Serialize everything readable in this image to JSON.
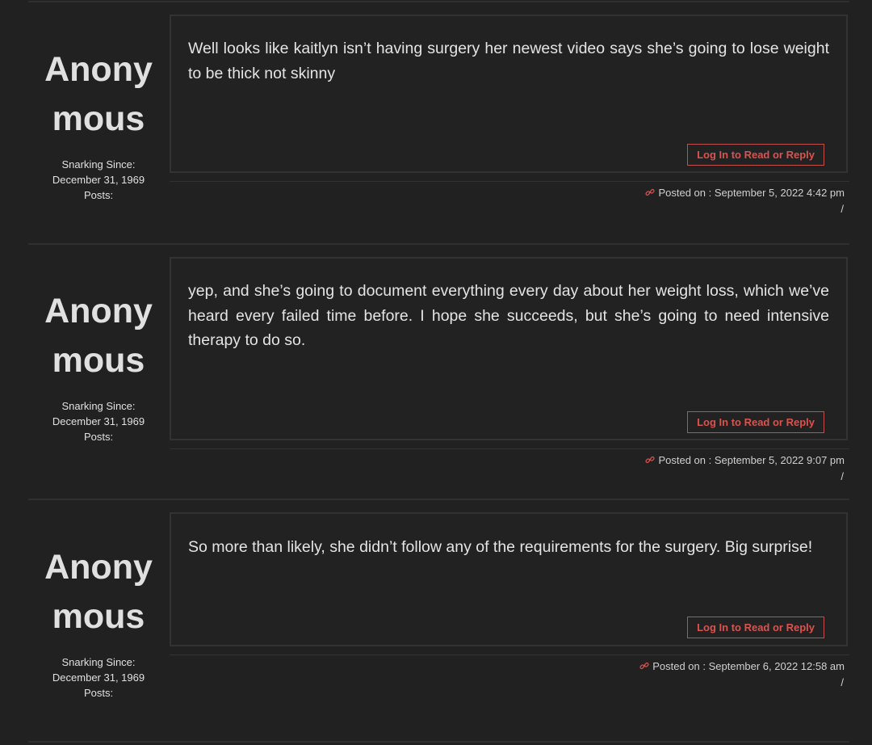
{
  "posts": [
    {
      "author": "Anonymous",
      "snarking_label": "Snarking Since:",
      "since_date": "December 31, 1969",
      "posts_label": "Posts:",
      "body": "Well looks like kaitlyn isn’t having surgery her newest video says she’s going to lose weight to be thick not skinny",
      "button": "Log In to Read or Reply",
      "posted": "Posted on : September 5, 2022 4:42 pm",
      "slash": "/"
    },
    {
      "author": "Anonymous",
      "snarking_label": "Snarking Since:",
      "since_date": "December 31, 1969",
      "posts_label": "Posts:",
      "body": "yep, and she’s going to document everything every day about her weight loss, which we’ve heard every failed time before. I hope she succeeds, but she’s going to need intensive therapy to do so.",
      "button": "Log In to Read or Reply",
      "posted": "Posted on : September 5, 2022 9:07 pm",
      "slash": "/"
    },
    {
      "author": "Anonymous",
      "snarking_label": "Snarking Since:",
      "since_date": "December 31, 1969",
      "posts_label": "Posts:",
      "body": "So more than likely, she didn’t follow any of the requirements for the surgery. Big surprise!",
      "button": "Log In to Read or Reply",
      "posted": "Posted on : September 6, 2022 12:58 am",
      "slash": "/"
    }
  ],
  "colors": {
    "background": "#212121",
    "accent": "#d9534f"
  },
  "icons": {
    "permalink": "link-icon"
  }
}
